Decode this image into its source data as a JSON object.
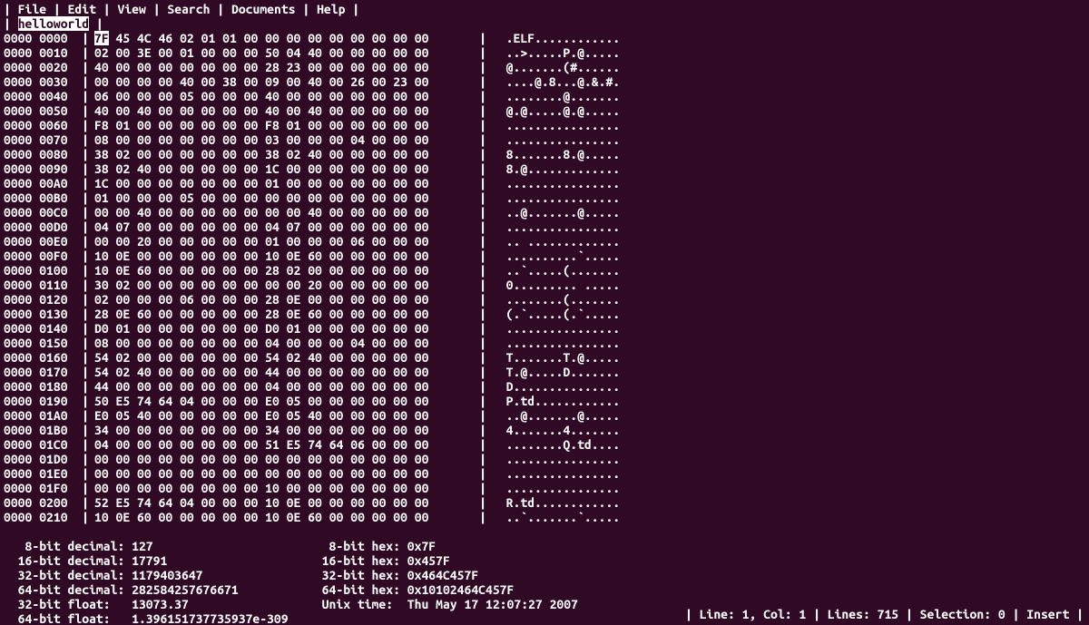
{
  "menu": {
    "items": [
      "File",
      "Edit",
      "View",
      "Search",
      "Documents",
      "Help"
    ]
  },
  "tabs": {
    "active": "helloworld"
  },
  "hex": {
    "rows": [
      {
        "addr": "0000 0000",
        "bytes": "7F 45 4C 46 02 01 01 00 00 00 00 00 00 00 00 00",
        "ascii": ".ELF............"
      },
      {
        "addr": "0000 0010",
        "bytes": "02 00 3E 00 01 00 00 00 50 04 40 00 00 00 00 00",
        "ascii": "..>.....P.@....."
      },
      {
        "addr": "0000 0020",
        "bytes": "40 00 00 00 00 00 00 00 28 23 00 00 00 00 00 00",
        "ascii": "@.......(#......"
      },
      {
        "addr": "0000 0030",
        "bytes": "00 00 00 00 40 00 38 00 09 00 40 00 26 00 23 00",
        "ascii": "....@.8...@.&.#."
      },
      {
        "addr": "0000 0040",
        "bytes": "06 00 00 00 05 00 00 00 40 00 00 00 00 00 00 00",
        "ascii": "........@......."
      },
      {
        "addr": "0000 0050",
        "bytes": "40 00 40 00 00 00 00 00 40 00 40 00 00 00 00 00",
        "ascii": "@.@.....@.@....."
      },
      {
        "addr": "0000 0060",
        "bytes": "F8 01 00 00 00 00 00 00 F8 01 00 00 00 00 00 00",
        "ascii": "................"
      },
      {
        "addr": "0000 0070",
        "bytes": "08 00 00 00 00 00 00 00 03 00 00 00 04 00 00 00",
        "ascii": "................"
      },
      {
        "addr": "0000 0080",
        "bytes": "38 02 00 00 00 00 00 00 38 02 40 00 00 00 00 00",
        "ascii": "8.......8.@....."
      },
      {
        "addr": "0000 0090",
        "bytes": "38 02 40 00 00 00 00 00 1C 00 00 00 00 00 00 00",
        "ascii": "8.@............."
      },
      {
        "addr": "0000 00A0",
        "bytes": "1C 00 00 00 00 00 00 00 01 00 00 00 00 00 00 00",
        "ascii": "................"
      },
      {
        "addr": "0000 00B0",
        "bytes": "01 00 00 00 05 00 00 00 00 00 00 00 00 00 00 00",
        "ascii": "................"
      },
      {
        "addr": "0000 00C0",
        "bytes": "00 00 40 00 00 00 00 00 00 00 40 00 00 00 00 00",
        "ascii": "..@.......@....."
      },
      {
        "addr": "0000 00D0",
        "bytes": "04 07 00 00 00 00 00 00 04 07 00 00 00 00 00 00",
        "ascii": "................"
      },
      {
        "addr": "0000 00E0",
        "bytes": "00 00 20 00 00 00 00 00 01 00 00 00 06 00 00 00",
        "ascii": ".. ............."
      },
      {
        "addr": "0000 00F0",
        "bytes": "10 0E 00 00 00 00 00 00 10 0E 60 00 00 00 00 00",
        "ascii": "..........`....."
      },
      {
        "addr": "0000 0100",
        "bytes": "10 0E 60 00 00 00 00 00 28 02 00 00 00 00 00 00",
        "ascii": "..`.....(......."
      },
      {
        "addr": "0000 0110",
        "bytes": "30 02 00 00 00 00 00 00 00 00 20 00 00 00 00 00",
        "ascii": "0......... ....."
      },
      {
        "addr": "0000 0120",
        "bytes": "02 00 00 00 06 00 00 00 28 0E 00 00 00 00 00 00",
        "ascii": "........(......."
      },
      {
        "addr": "0000 0130",
        "bytes": "28 0E 60 00 00 00 00 00 28 0E 60 00 00 00 00 00",
        "ascii": "(.`.....(.`....."
      },
      {
        "addr": "0000 0140",
        "bytes": "D0 01 00 00 00 00 00 00 D0 01 00 00 00 00 00 00",
        "ascii": "................"
      },
      {
        "addr": "0000 0150",
        "bytes": "08 00 00 00 00 00 00 00 04 00 00 00 04 00 00 00",
        "ascii": "................"
      },
      {
        "addr": "0000 0160",
        "bytes": "54 02 00 00 00 00 00 00 54 02 40 00 00 00 00 00",
        "ascii": "T.......T.@....."
      },
      {
        "addr": "0000 0170",
        "bytes": "54 02 40 00 00 00 00 00 44 00 00 00 00 00 00 00",
        "ascii": "T.@.....D......."
      },
      {
        "addr": "0000 0180",
        "bytes": "44 00 00 00 00 00 00 00 04 00 00 00 00 00 00 00",
        "ascii": "D..............."
      },
      {
        "addr": "0000 0190",
        "bytes": "50 E5 74 64 04 00 00 00 E0 05 00 00 00 00 00 00",
        "ascii": "P.td............"
      },
      {
        "addr": "0000 01A0",
        "bytes": "E0 05 40 00 00 00 00 00 E0 05 40 00 00 00 00 00",
        "ascii": "..@.......@....."
      },
      {
        "addr": "0000 01B0",
        "bytes": "34 00 00 00 00 00 00 00 34 00 00 00 00 00 00 00",
        "ascii": "4.......4......."
      },
      {
        "addr": "0000 01C0",
        "bytes": "04 00 00 00 00 00 00 00 51 E5 74 64 06 00 00 00",
        "ascii": "........Q.td...."
      },
      {
        "addr": "0000 01D0",
        "bytes": "00 00 00 00 00 00 00 00 00 00 00 00 00 00 00 00",
        "ascii": "................"
      },
      {
        "addr": "0000 01E0",
        "bytes": "00 00 00 00 00 00 00 00 00 00 00 00 00 00 00 00",
        "ascii": "................"
      },
      {
        "addr": "0000 01F0",
        "bytes": "00 00 00 00 00 00 00 00 10 00 00 00 00 00 00 00",
        "ascii": "................"
      },
      {
        "addr": "0000 0200",
        "bytes": "52 E5 74 64 04 00 00 00 10 0E 00 00 00 00 00 00",
        "ascii": "R.td............"
      },
      {
        "addr": "0000 0210",
        "bytes": "10 0E 60 00 00 00 00 00 10 0E 60 00 00 00 00 00",
        "ascii": "..`.......`....."
      }
    ]
  },
  "info": {
    "dec8_label": "   8-bit decimal: ",
    "dec8": "127",
    "dec16_label": "  16-bit decimal: ",
    "dec16": "17791",
    "dec32_label": "  32-bit decimal: ",
    "dec32": "1179403647",
    "dec64_label": "  64-bit decimal: ",
    "dec64": "282584257676671",
    "flt32_label": "  32-bit float:   ",
    "flt32": "13073.37",
    "flt64_label": "  64-bit float:   ",
    "flt64": "1.396151737735937e-309",
    "hex8_label": "   8-bit hex: ",
    "hex8": "0x7F",
    "hex16_label": "  16-bit hex: ",
    "hex16": "0x457F",
    "hex32_label": "  32-bit hex: ",
    "hex32": "0x464C457F",
    "hex64_label": "  64-bit hex: ",
    "hex64": "0x10102464C457F",
    "utime_label": "  Unix time:  ",
    "utime": "Thu May 17 12:07:27 2007"
  },
  "status": {
    "text": "| Line: 1, Col: 1 | Lines: 715 | Selection: 0 | Insert |"
  }
}
